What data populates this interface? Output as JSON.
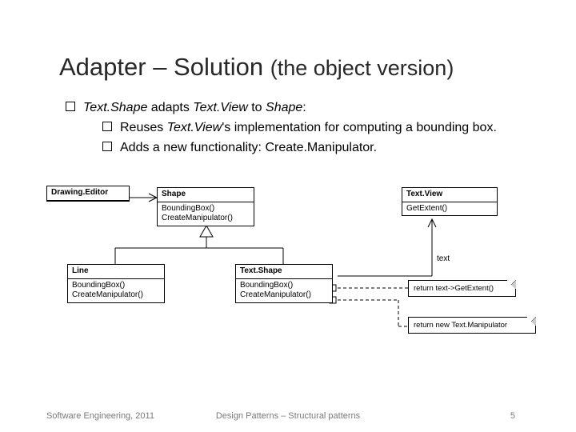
{
  "title": {
    "main": "Adapter",
    "dash": " – ",
    "sub": "Solution",
    "paren": "(the object version)"
  },
  "bullets": {
    "b1_a": "Text.Shape",
    "b1_b": " adapts ",
    "b1_c": "Text.View",
    "b1_d": " to ",
    "b1_e": "Shape",
    "b1_f": ":",
    "s1_a": "Reuses ",
    "s1_b": "Text.View",
    "s1_c": "'s implementation for computing a bounding box.",
    "s2": "Adds a new functionality: Create.Manipulator."
  },
  "uml": {
    "drawingEditor": {
      "name": "Drawing.Editor"
    },
    "shape": {
      "name": "Shape",
      "m1": "BoundingBox()",
      "m2": "CreateManipulator()"
    },
    "textView": {
      "name": "Text.View",
      "m1": "GetExtent()"
    },
    "line": {
      "name": "Line",
      "m1": "BoundingBox()",
      "m2": "CreateManipulator()"
    },
    "textShape": {
      "name": "Text.Shape",
      "m1": "BoundingBox()",
      "m2": "CreateManipulator()"
    },
    "note1": "return text->GetExtent()",
    "note2": "return new Text.Manipulator",
    "assocLabel": "text"
  },
  "footer": {
    "left": "Software Engineering, 2011",
    "center": "Design Patterns – Structural patterns",
    "right": "5"
  }
}
